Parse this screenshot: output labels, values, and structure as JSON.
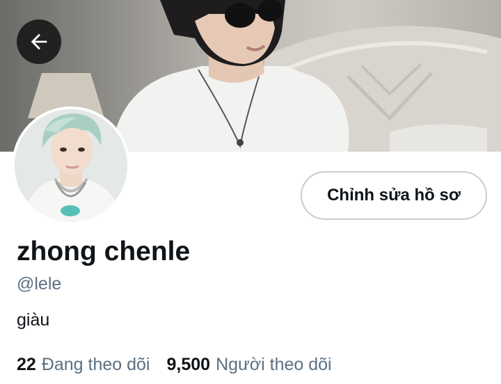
{
  "profile": {
    "display_name": "zhong chenle",
    "handle": "@lele",
    "bio": "giàu",
    "edit_button_label": "Chỉnh sửa hồ sơ"
  },
  "stats": {
    "following_count": "22",
    "following_label": "Đang theo dõi",
    "followers_count": "9,500",
    "followers_label": "Người theo dõi"
  },
  "icons": {
    "back": "arrow-left-icon"
  },
  "colors": {
    "text_primary": "#0f1419",
    "text_secondary": "#5b7083",
    "button_border": "#c7ccd1",
    "back_button_bg": "#141414"
  }
}
